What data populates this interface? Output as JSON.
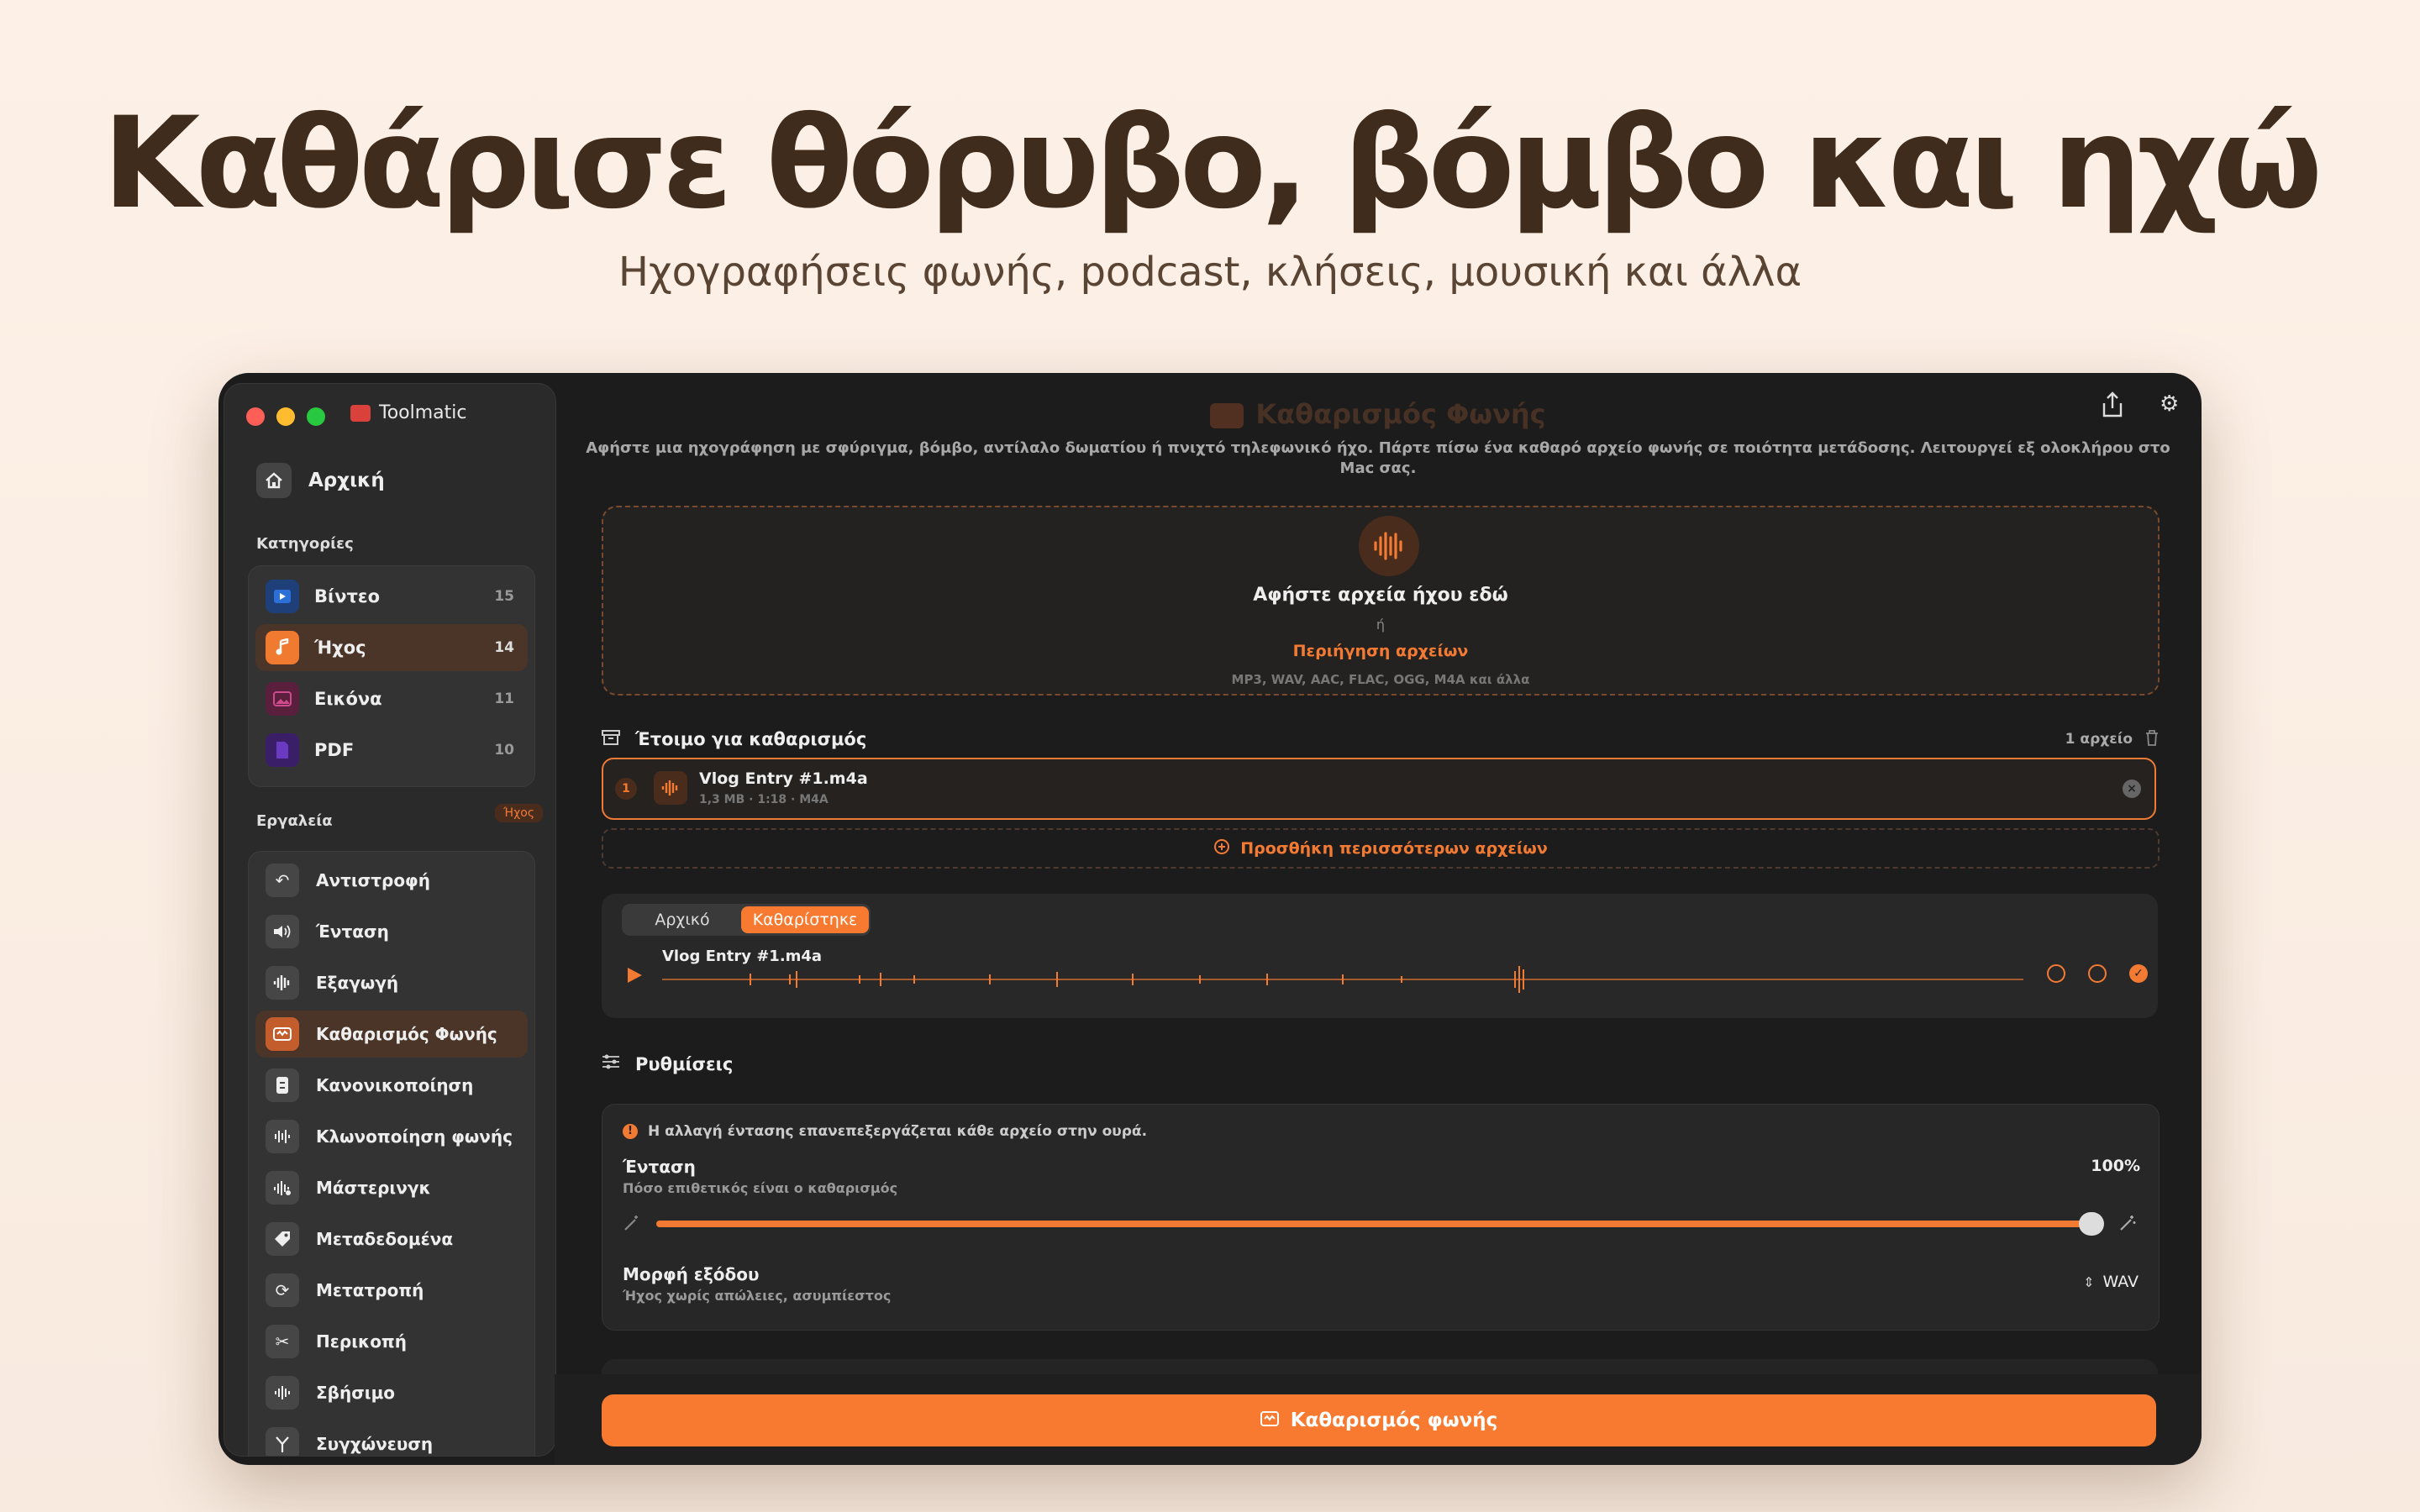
{
  "hero": {
    "title": "Καθάρισε θόρυβο, βόμβο και ηχώ",
    "subtitle": "Ηχογραφήσεις φωνής, podcast, κλήσεις, μουσική και άλλα"
  },
  "window": {
    "app_name": "Toolmatic",
    "traffic_colors": [
      "#ff5f57",
      "#febc2e",
      "#28c840"
    ]
  },
  "sidebar": {
    "home_label": "Αρχική",
    "categories_label": "Κατηγορίες",
    "categories": [
      {
        "label": "Βίντεο",
        "count": "15",
        "color": "#2c6fd6",
        "icon": "play-icon"
      },
      {
        "label": "Ήχος",
        "count": "14",
        "color": "#f07a30",
        "icon": "music-note-icon"
      },
      {
        "label": "Εικόνα",
        "count": "11",
        "color": "#c23b7e",
        "icon": "image-icon"
      },
      {
        "label": "PDF",
        "count": "10",
        "color": "#6a3bc2",
        "icon": "pdf-icon"
      }
    ],
    "tools_label": "Εργαλεία",
    "tools_badge": "Ήχος",
    "tools": [
      {
        "label": "Αντιστροφή",
        "icon": "reverse-icon"
      },
      {
        "label": "Ένταση",
        "icon": "speaker-icon"
      },
      {
        "label": "Εξαγωγή",
        "icon": "waveform-icon"
      },
      {
        "label": "Καθαρισμός Φωνής",
        "icon": "voice-clean-icon"
      },
      {
        "label": "Κανονικοποίηση",
        "icon": "normalize-icon"
      },
      {
        "label": "Κλωνοποίηση φωνής",
        "icon": "voice-clone-icon"
      },
      {
        "label": "Μάστερινγκ",
        "icon": "mastering-icon"
      },
      {
        "label": "Μεταδεδομένα",
        "icon": "tag-icon"
      },
      {
        "label": "Μετατροπή",
        "icon": "convert-icon"
      },
      {
        "label": "Περικοπή",
        "icon": "scissors-icon"
      },
      {
        "label": "Σβήσιμο",
        "icon": "fade-icon"
      },
      {
        "label": "Συγχώνευση",
        "icon": "merge-icon"
      }
    ]
  },
  "main": {
    "title": "Καθαρισμός Φωνής",
    "intro": "Αφήστε μια ηχογράφηση με σφύριγμα, βόμβο, αντίλαλο δωματίου ή πνιχτό τηλεφωνικό ήχο. Πάρτε πίσω ένα καθαρό αρχείο φωνής σε ποιότητα μετάδοσης. Λειτουργεί εξ ολοκλήρου στο Mac σας.",
    "dropzone": {
      "title": "Αφήστε αρχεία ήχου εδώ",
      "or": "ή",
      "browse": "Περιήγηση αρχείων",
      "formats": "MP3, WAV, AAC, FLAC, OGG, M4A και άλλα"
    },
    "queue": {
      "title": "Έτοιμο για καθαρισμός",
      "count": "1 αρχείο",
      "file": {
        "index": "1",
        "name": "Vlog Entry #1.m4a",
        "meta": "1,3 MB · 1:18 · M4A"
      },
      "add_more": "Προσθήκη περισσότερων αρχείων"
    },
    "player": {
      "tab_original": "Αρχικό",
      "tab_cleaned": "Καθαρίστηκε",
      "file_name": "Vlog Entry #1.m4a"
    },
    "settings": {
      "label": "Ρυθμίσεις",
      "notice": "Η αλλαγή έντασης επανεπεξεργάζεται κάθε αρχείο στην ουρά.",
      "intensity_label": "Ένταση",
      "intensity_desc": "Πόσο επιθετικός είναι ο καθαρισμός",
      "intensity_value": "100%",
      "intensity_fraction": 1.0,
      "format_label": "Μορφή εξόδου",
      "format_desc": "Ήχος χωρίς απώλειες, ασυμπίεστος",
      "format_value": "WAV"
    },
    "cta": "Καθαρισμός φωνής"
  },
  "colors": {
    "accent": "#f77a30",
    "background": "#1c1c1c"
  }
}
